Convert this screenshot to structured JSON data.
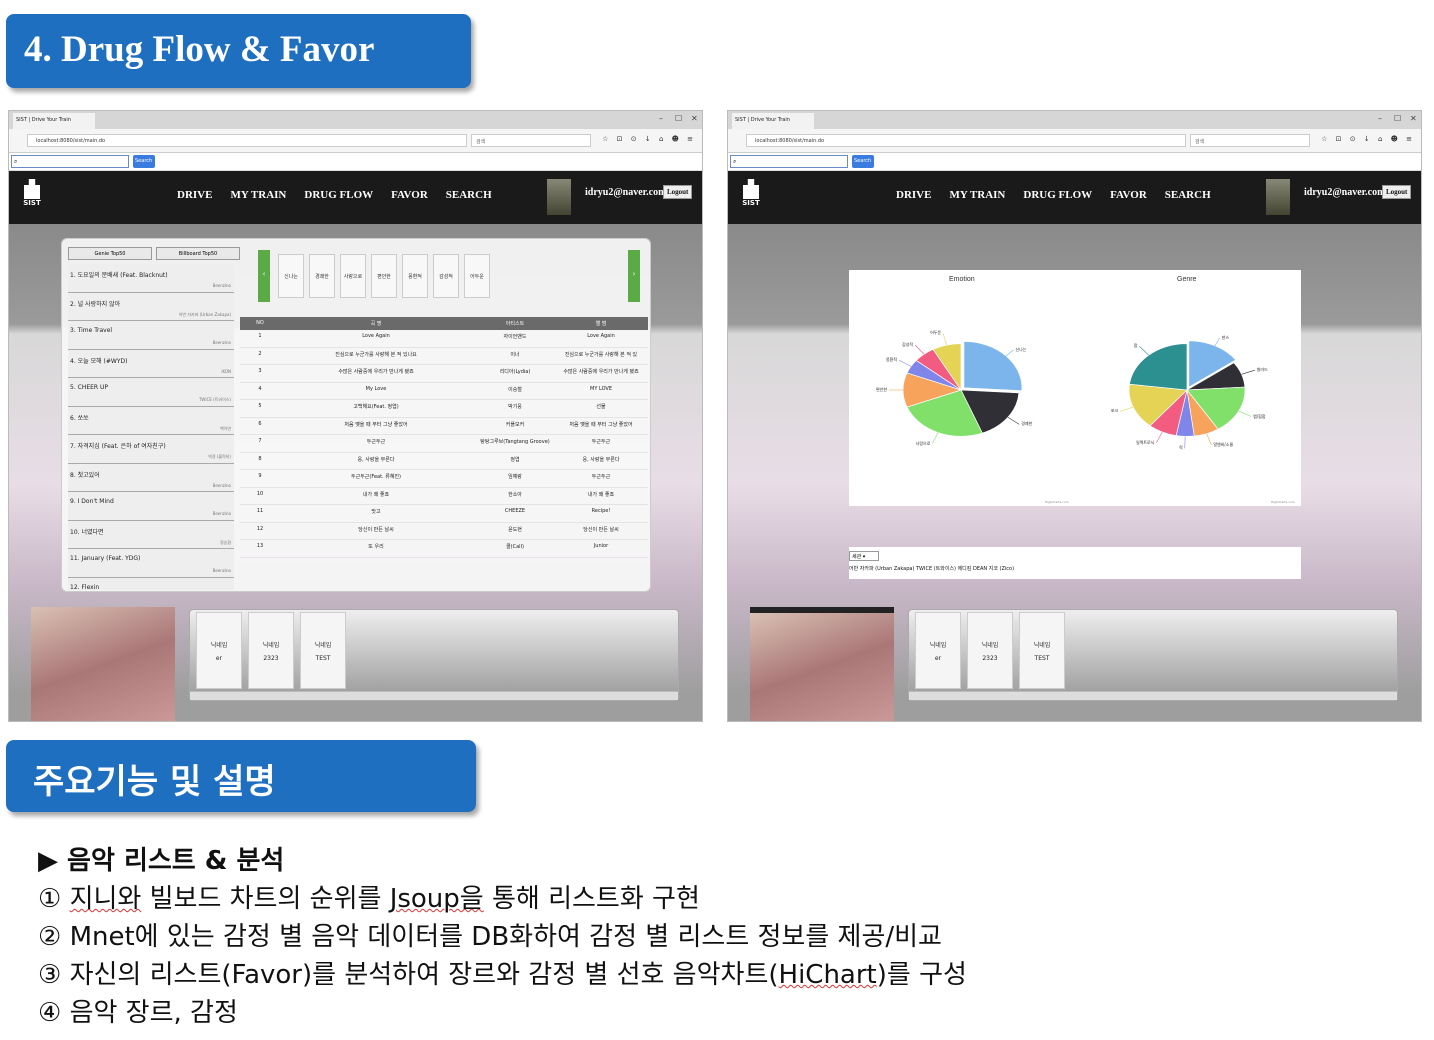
{
  "section_title": "4. Drug Flow & Favor",
  "desc_title": "주요기능 및 설명",
  "browser": {
    "tab_title": "SIST | Drive Your Train",
    "url": "localhost:8080/sist/main.do",
    "search_placeholder": "검색",
    "find_button": "Search",
    "win_min": "–",
    "win_max": "☐",
    "win_close": "✕",
    "tools": "☆ ⊡ ⊙ ↓ ⌂ ☻ ≡"
  },
  "nav": {
    "logo": "SIST",
    "items": [
      "DRIVE",
      "MY TRAIN",
      "DRUG FLOW",
      "FAVOR",
      "SEARCH"
    ],
    "email": "idryu2@naver.com",
    "logout": "Logout"
  },
  "list_tabs": [
    "Genie Top50",
    "Billboard Top50"
  ],
  "top_list": [
    {
      "title": "1. 도요일의 문배새 (Feat. Blacknut)",
      "artist": "Beenzino"
    },
    {
      "title": "2. 널 사랑하지 않아",
      "artist": "어반 자카파 (Urban Zakapa)"
    },
    {
      "title": "3. Time Travel",
      "artist": "Beenzino"
    },
    {
      "title": "4. 오늘 모해 (#WYD)",
      "artist": "iKON"
    },
    {
      "title": "5. CHEER UP",
      "artist": "TWICE (트와이스)"
    },
    {
      "title": "6. 쏘쏘",
      "artist": "백아연"
    },
    {
      "title": "7. 자격지심 (Feat. 은하 of 여자친구)",
      "artist": "박경 (블락비)"
    },
    {
      "title": "8. 첫고있어",
      "artist": "Beenzino"
    },
    {
      "title": "9. I Don't Mind",
      "artist": "Beenzino"
    },
    {
      "title": "10. 너였다면",
      "artist": "정승환"
    },
    {
      "title": "11. January (Feat. YDG)",
      "artist": "Beenzino"
    },
    {
      "title": "12. Flexin",
      "artist": ""
    }
  ],
  "emotions": [
    "신나는",
    "경쾌한",
    "사랑으로",
    "편안한",
    "몽환적",
    "감성적",
    "어두운"
  ],
  "table": {
    "headers": [
      "NO",
      "곡 명",
      "아티스트",
      "앨 범"
    ],
    "rows": [
      [
        "1",
        "Love Again",
        "자이언밴드",
        "Love Again"
      ],
      [
        "2",
        "진심으로 누군가를 사랑해 본 적 있나요",
        "이너",
        "진심으로 누군가를 사랑해 본 적 있"
      ],
      [
        "3",
        "수많은 사람중에 우리가 만나게 됐죠",
        "리디아(Lydia)",
        "수많은 사람중에 우리가 만나게 됐죠"
      ],
      [
        "4",
        "My Love",
        "이승철",
        "MY LOVE"
      ],
      [
        "5",
        "고백해요(Feat. 정엽)",
        "박기웅",
        "선물"
      ],
      [
        "6",
        "처음 맺을 때 부터 그냥 좋았어",
        "커플모커",
        "처음 맺을 때 부터 그냥 좋았어"
      ],
      [
        "7",
        "두근두근",
        "탕탕그루브(Tangtang Groove)",
        "두근두근"
      ],
      [
        "8",
        "응, 사랑을 부른다",
        "정엽",
        "응, 사랑을 부른다"
      ],
      [
        "9",
        "두근두근(Feat. 류혜진)",
        "임예랑",
        "두근두근"
      ],
      [
        "10",
        "내가 왜 좋죠",
        "한소아",
        "내가 왜 좋죠"
      ],
      [
        "11",
        "맛고",
        "CHEEZE",
        "Recipe!"
      ],
      [
        "12",
        "당신이 만든 날씨",
        "윤도현",
        "당신이 만든 날씨"
      ],
      [
        "13",
        "또 우리",
        "콜(Call)",
        "Junior"
      ]
    ]
  },
  "friends": [
    {
      "label": "닉네임",
      "value": "er"
    },
    {
      "label": "닉네임",
      "value": "2323"
    },
    {
      "label": "닉네임",
      "value": "TEST"
    }
  ],
  "chart_data": [
    {
      "type": "pie",
      "title": "Emotion",
      "categories": [
        "신나는",
        "경쾌한",
        "사랑으로",
        "편안한",
        "몽환적",
        "감성적",
        "어두운"
      ],
      "values": [
        26,
        18,
        25,
        12,
        5,
        6,
        8
      ],
      "colors": [
        "#7cb5ec",
        "#2f2f35",
        "#80e06a",
        "#f7a35c",
        "#8085e9",
        "#f15c80",
        "#e4d354"
      ]
    },
    {
      "type": "pie",
      "title": "Genre",
      "categories": [
        "댄스",
        "발라드",
        "랩/힙합",
        "알앤비/소울",
        "락",
        "일렉트로닉",
        "포크",
        "팝"
      ],
      "values": [
        15,
        9,
        17,
        7,
        5,
        8,
        16,
        23
      ],
      "colors": [
        "#7cb5ec",
        "#2f2f35",
        "#80e06a",
        "#f7a35c",
        "#8085e9",
        "#f15c80",
        "#e4d354",
        "#2b908f"
      ]
    }
  ],
  "chart_credit": "Highcharts.com",
  "select_value": "세관",
  "artist_line": "어반 자카파 (Urban Zakapa) TWICE (트와이스) 에디킴 DEAN 지코 (Zico)",
  "features": {
    "heading": "▶ 음악 리스트 & 분석",
    "l1a": "① ",
    "l1b": "지니와",
    "l1c": " 빌보드 차트의 순위를 ",
    "l1d": "Jsoup을",
    "l1e": " 통해 리스트화 구현",
    "l2": "② Mnet에 있는 감정 별 음악 데이터를 DB화하여 감정 별 리스트 정보를 제공/비교",
    "l3a": "③ 자신의 리스트(Favor)를 분석하여 장르와 감정 별 선호 음악차트(",
    "l3b": "HiChart",
    "l3c": ")를 구성",
    "l4": "④ 음악 장르, 감정"
  }
}
